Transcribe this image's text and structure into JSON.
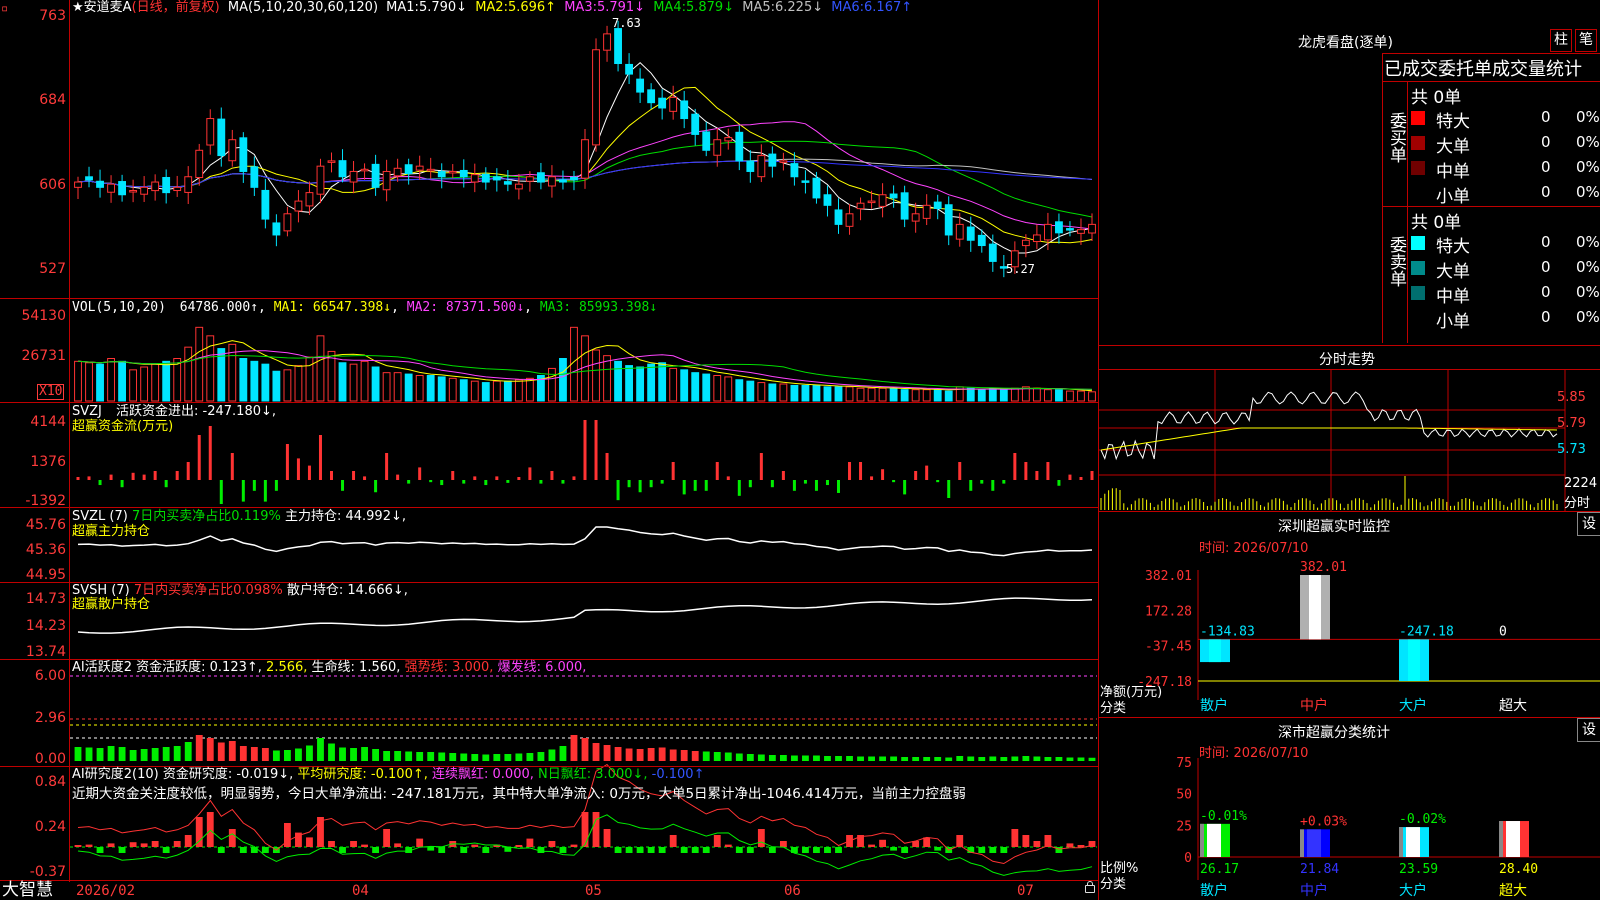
{
  "colors": {
    "up": "#ff3333",
    "down": "#00e5ff",
    "ma1": "#ffffff",
    "ma2": "#ffff00",
    "ma3": "#ff44ff",
    "ma4": "#00dd00",
    "ma5": "#c0c0c0",
    "ma6": "#3333ff",
    "grid": "#c00000",
    "axis": "#ff3b3b"
  },
  "top_icon": "▫",
  "price_panel": {
    "name_label": "★安道麦A",
    "period_label": "(日线，前复权)",
    "ma_title": "MA(5,10,20,30,60,120)",
    "ma": [
      {
        "name": "MA1:",
        "value": "5.790↓"
      },
      {
        "name": "MA2:",
        "value": "5.696↑"
      },
      {
        "name": "MA3:",
        "value": "5.791↓"
      },
      {
        "name": "MA4:",
        "value": "5.879↓"
      },
      {
        "name": "MA5:",
        "value": "6.225↓"
      },
      {
        "name": "MA6:",
        "value": "6.167↑"
      }
    ],
    "y_ticks": [
      "763",
      "684",
      "606",
      "527"
    ],
    "high_label": "7.63",
    "low_label": "5.27"
  },
  "vol_panel": {
    "title": "VOL(5,10,20)",
    "value": "64786.000↑",
    "ma1": "MA1: 66547.398↓",
    "ma2": "MA2: 87371.500↓",
    "ma3": "MA3: 85993.398↓",
    "y_ticks": [
      "54130",
      "26731"
    ],
    "unit": "X10"
  },
  "svzj_panel": {
    "title": "SVZJ",
    "text": "活跃资金进出: -247.180↓,",
    "sub": "超赢资金流(万元)",
    "y_ticks": [
      "4144",
      "1376",
      "-1392"
    ]
  },
  "svzl_panel": {
    "title": "SVZL (7)",
    "text": "7日内买卖净占比0.119%",
    "text2": "主力持仓: 44.992↓,",
    "sub": "超赢主力持仓",
    "y_ticks": [
      "45.76",
      "45.36",
      "44.95"
    ]
  },
  "svsh_panel": {
    "title": "SVSH (7)",
    "text": "7日内买卖净占比0.098%",
    "text2": "散户持仓: 14.666↓,",
    "sub": "超赢散户持仓",
    "y_ticks": [
      "14.73",
      "14.23",
      "13.74"
    ]
  },
  "ai2_panel": {
    "title": "AI活跃度2",
    "t1": "资金活跃度: 0.123↑,",
    "t2": "2.566,",
    "t3": "生命线: 1.560,",
    "t4": "强势线: 3.000,",
    "t5": "爆发线: 6.000,",
    "y_ticks": [
      "6.00",
      "2.96",
      "0.00"
    ]
  },
  "ai3_panel": {
    "title": "AI研究度2(10)",
    "t1": "资金研究度: -0.019↓,",
    "t2": "平均研究度: -0.100↑,",
    "t3": "连续飘红: 0.000,",
    "t4": "N日飘红: 3.000↓,",
    "t5": "-0.100↑",
    "comment": "近期大资金关注度较低，明显弱势，今日大单净流出: -247.181万元，其中特大单净流入: 0万元，大单5日累计净出-1046.414万元，当前主力控盘弱",
    "y_ticks": [
      "0.84",
      "0.24",
      "-0.37"
    ]
  },
  "date_axis": {
    "brand": "大智慧",
    "labels": [
      "2026/02",
      "04",
      "05",
      "06",
      "07"
    ]
  },
  "chart_data": {
    "type": "line",
    "title": "★安道麦A (日线，前复权)",
    "dates": [
      "2026/02",
      "04",
      "05",
      "06",
      "07"
    ],
    "close": [
      6.1,
      6.12,
      6.05,
      6.08,
      5.98,
      6.02,
      6.05,
      6.1,
      6.0,
      6.05,
      6.15,
      6.4,
      6.7,
      6.35,
      6.5,
      6.2,
      6.05,
      5.75,
      5.6,
      5.8,
      5.92,
      6.0,
      6.25,
      6.3,
      6.15,
      6.2,
      6.22,
      6.05,
      6.2,
      6.23,
      6.18,
      6.25,
      6.22,
      6.15,
      6.2,
      6.15,
      6.17,
      6.1,
      6.12,
      6.08,
      6.08,
      6.15,
      6.1,
      6.15,
      6.1,
      6.12,
      6.5,
      7.35,
      7.5,
      7.22,
      7.12,
      6.95,
      6.85,
      6.8,
      6.9,
      6.7,
      6.55,
      6.4,
      6.5,
      6.52,
      6.3,
      6.2,
      6.35,
      6.25,
      6.3,
      6.15,
      6.1,
      5.95,
      5.88,
      5.7,
      5.8,
      5.9,
      5.92,
      5.98,
      5.95,
      5.75,
      5.8,
      5.88,
      5.85,
      5.6,
      5.7,
      5.55,
      5.5,
      5.35,
      5.3,
      5.45,
      5.55,
      5.6,
      5.7,
      5.62,
      5.65,
      5.65,
      5.7
    ],
    "volume_x10": [
      28000,
      27000,
      26000,
      30000,
      28000,
      22000,
      24000,
      26000,
      28000,
      30000,
      38000,
      52000,
      46000,
      37000,
      40000,
      30000,
      28000,
      26000,
      21000,
      22000,
      25000,
      31000,
      46000,
      35000,
      27000,
      26000,
      28000,
      24000,
      20000,
      20000,
      19000,
      18000,
      18000,
      17000,
      16000,
      15000,
      14000,
      13000,
      14000,
      14000,
      15000,
      16000,
      18000,
      23000,
      30000,
      52000,
      46000,
      36000,
      32000,
      28000,
      25000,
      24000,
      26000,
      27000,
      23000,
      22000,
      20000,
      19000,
      18000,
      17000,
      15000,
      14000,
      13000,
      12000,
      12000,
      11000,
      11000,
      11000,
      10000,
      10000,
      10000,
      9000,
      9000,
      9000,
      9000,
      8000,
      8000,
      8000,
      8000,
      7000,
      10000,
      9000,
      8000,
      9000,
      8000,
      9000,
      10000,
      9000,
      8000,
      8000,
      7000,
      7000,
      6478
    ],
    "sz_realtime_monitor": {
      "categories": [
        "散户",
        "中户",
        "大户",
        "超大"
      ],
      "values": [
        -134.83,
        382.01,
        -247.18,
        0
      ],
      "ylim": [
        -247.18,
        382.01
      ]
    },
    "sz_category_stats": {
      "categories": [
        "散户",
        "中户",
        "大户",
        "超大"
      ],
      "ratio": [
        26.17,
        21.84,
        23.59,
        28.4
      ],
      "change": [
        "-0.01%",
        "+0.03%",
        "-0.02%",
        ""
      ]
    }
  },
  "right_panel": {
    "dragon_title": "龙虎看盘(逐单)",
    "btn1": "柱",
    "btn2": "笔",
    "stat_title": "已成交委托单成交量统计",
    "buy_label": "委买单",
    "sell_label": "委卖单",
    "buy_total": "共 0单",
    "sell_total": "共 0单",
    "buy_rows": [
      {
        "name": "特大",
        "count": "0",
        "pct": "0%",
        "color": "#ff0000"
      },
      {
        "name": "大单",
        "count": "0",
        "pct": "0%",
        "color": "#a00000"
      },
      {
        "name": "中单",
        "count": "0",
        "pct": "0%",
        "color": "#700000"
      },
      {
        "name": "小单",
        "count": "0",
        "pct": "0%",
        "color": "#000000"
      }
    ],
    "sell_rows": [
      {
        "name": "特大",
        "count": "0",
        "pct": "0%",
        "color": "#00ffff"
      },
      {
        "name": "大单",
        "count": "0",
        "pct": "0%",
        "color": "#008b8b"
      },
      {
        "name": "中单",
        "count": "0",
        "pct": "0%",
        "color": "#006f6f"
      },
      {
        "name": "小单",
        "count": "0",
        "pct": "0%",
        "color": "#000000"
      }
    ],
    "intraday_title": "分时走势",
    "intraday_prices": [
      "5.85",
      "5.79",
      "5.73"
    ],
    "intraday_vol": "2224",
    "intraday_vol_unit": "分时",
    "monitor_title": "深圳超赢实时监控",
    "monitor_time": "时间: 2026/07/10",
    "monitor_yticks": [
      "382.01",
      "172.28",
      "-37.45",
      "-247.18"
    ],
    "monitor_value_labels": [
      "-134.83",
      "382.01",
      "-247.18",
      "0"
    ],
    "monitor_net_label": "净额(万元)",
    "monitor_cat_label": "分类",
    "monitor_cats": [
      "散户",
      "中户",
      "大户",
      "超大"
    ],
    "stats_title": "深市超赢分类统计",
    "stats_time": "时间: 2026/07/10",
    "stats_yticks": [
      "75",
      "50",
      "25",
      "0"
    ],
    "stats_ratio_label": "比例%",
    "stats_cat_label": "分类",
    "stats_change_labels": [
      "-0.01%",
      "+0.03%",
      "-0.02%"
    ],
    "stats_values": [
      "26.17",
      "21.84",
      "23.59",
      "28.40"
    ],
    "stats_cats": [
      "散户",
      "中户",
      "大户",
      "超大"
    ],
    "set_btn": "设"
  }
}
